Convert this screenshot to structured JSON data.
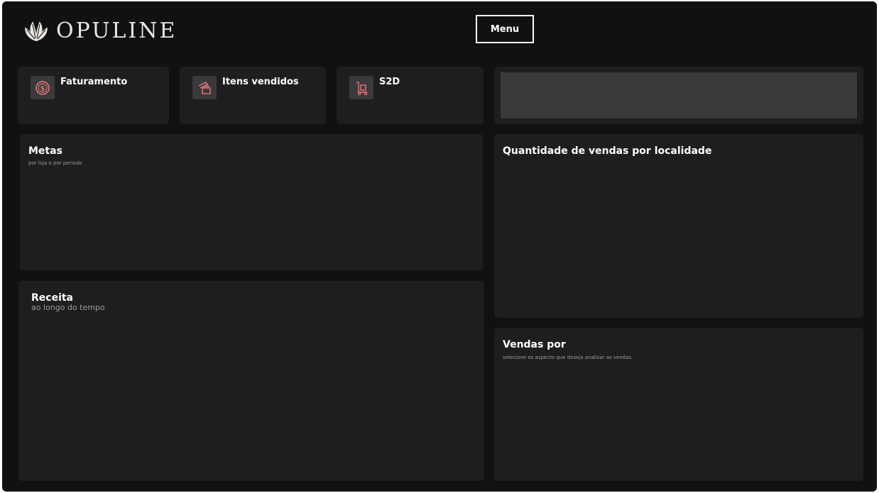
{
  "header": {
    "brand": "OPULINE",
    "menu_label": "Menu"
  },
  "kpis": [
    {
      "label": "Faturamento",
      "icon": "dollar-coin-icon"
    },
    {
      "label": "Itens vendidos",
      "icon": "shopping-bag-icon"
    },
    {
      "label": "S2D",
      "icon": "hand-truck-icon"
    }
  ],
  "panels": {
    "metas": {
      "title": "Metas",
      "subtitle": "por loja e por periodo"
    },
    "receita": {
      "title": "Receita",
      "subtitle": "ao longo do tempo"
    },
    "localidade": {
      "title": "Quantidade de vendas por localidade"
    },
    "vendas_por": {
      "title": "Vendas por",
      "subtitle": "selecione os aspecto que deseja analisar as vendas"
    }
  },
  "colors": {
    "background": "#111112",
    "card": "#1e1e20",
    "icon_tile": "#3a3a3c",
    "icon_accent": "#e07a7a",
    "filter_box": "#3a3a3a"
  }
}
